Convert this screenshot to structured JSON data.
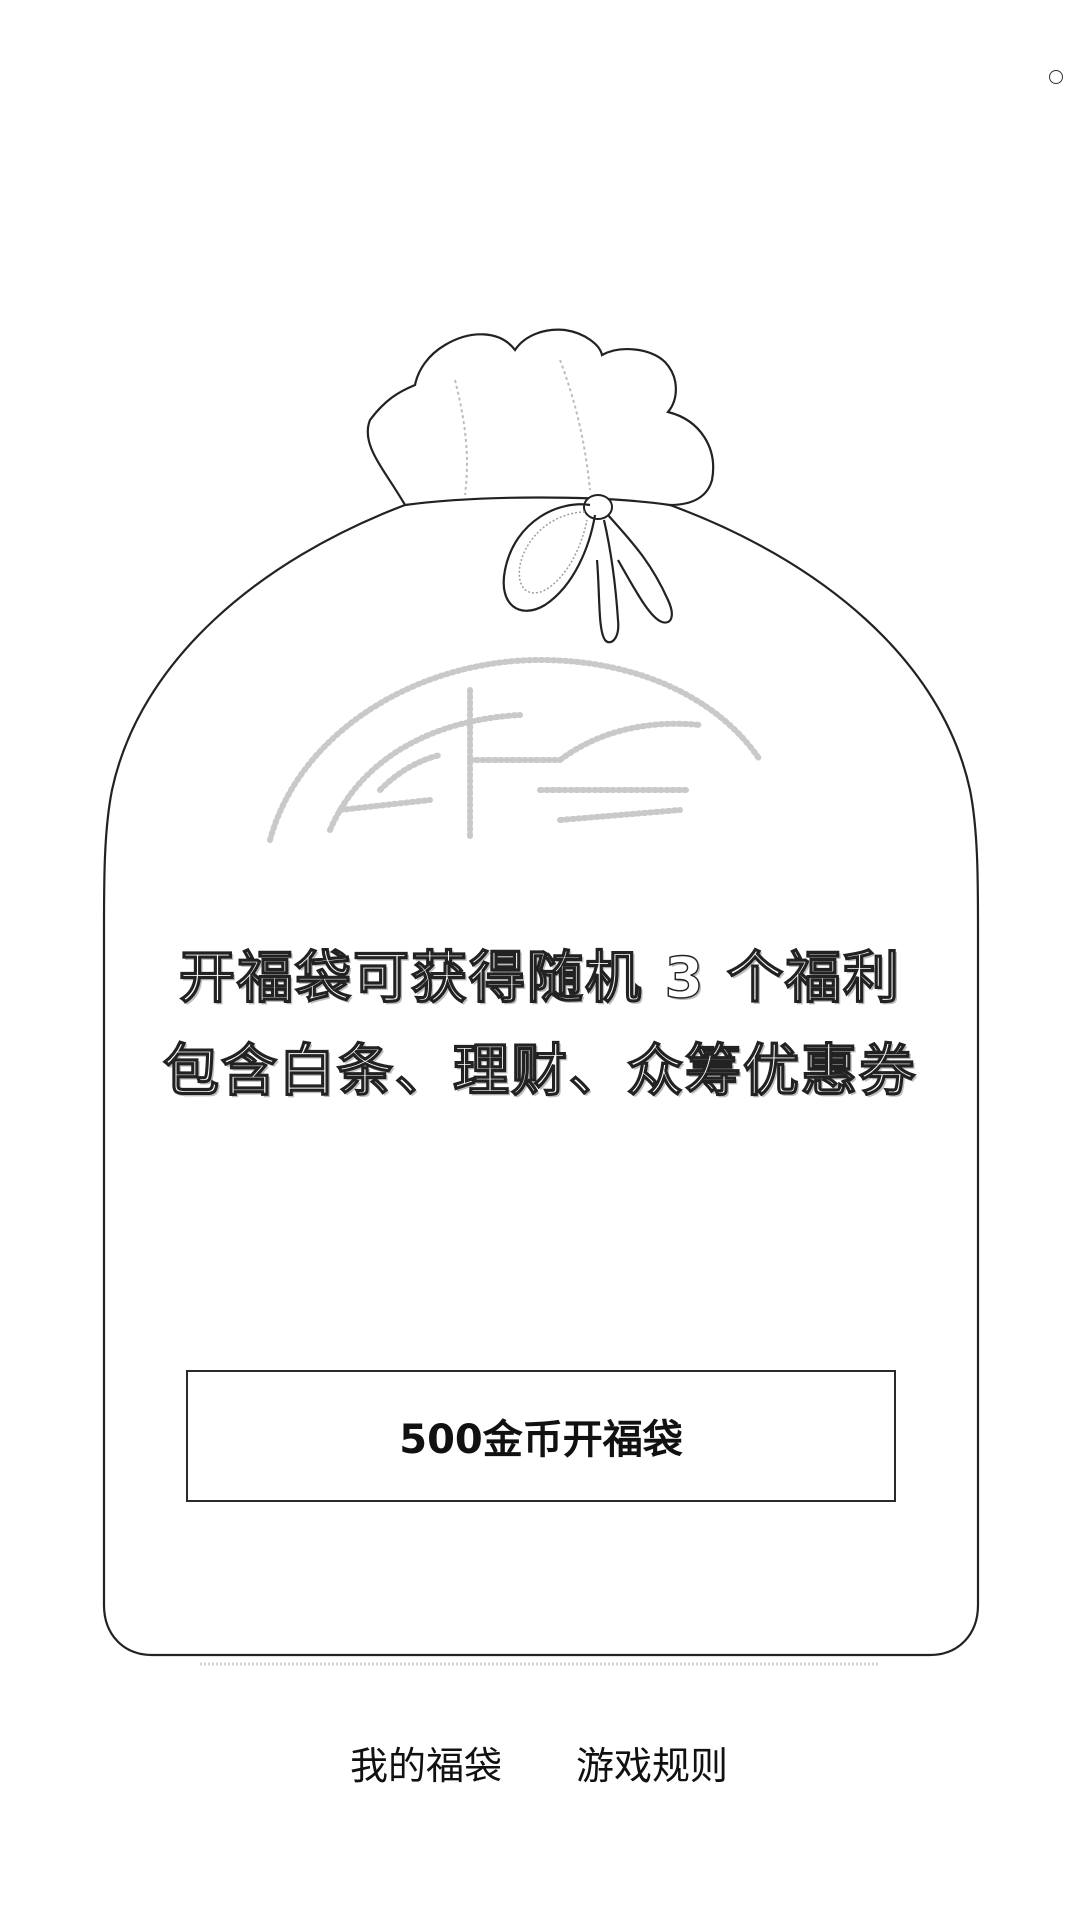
{
  "promo": {
    "line1": "开福袋可获得随机 3 个福利",
    "line2": "包含白条、理财、众筹优惠券"
  },
  "open_button": {
    "label": "500金币开福袋"
  },
  "footer": {
    "my_bags_label": "我的福袋",
    "rules_label": "游戏规则"
  },
  "icons": {
    "corner": "circle-icon",
    "bag": "lucky-bag-icon",
    "emblem": "fu-character-emblem-icon"
  },
  "colors": {
    "background": "#ffffff",
    "outline": "#222222",
    "text": "#111111"
  }
}
